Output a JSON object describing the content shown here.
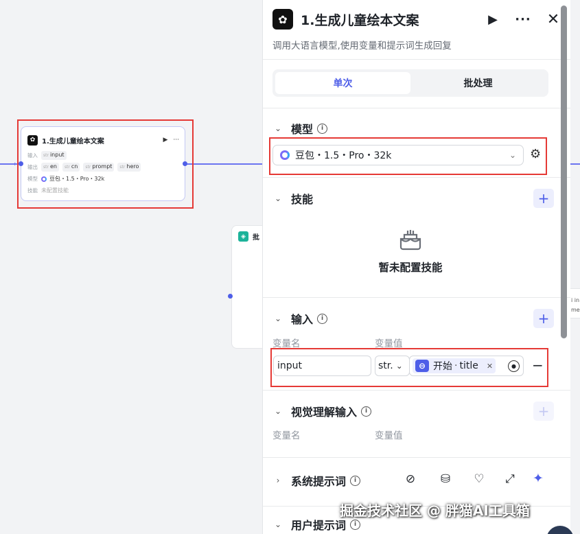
{
  "canvas": {
    "node1": {
      "title": "1.生成儿童绘本文案",
      "run_icon": "▶",
      "more_icon": "···",
      "input_key": "输入",
      "input_tag": "input",
      "output_key": "输出",
      "output_tags": [
        "en",
        "cn",
        "prompt",
        "hero"
      ],
      "model_key": "模型",
      "model": "豆包・1.5・Pro・32k",
      "skill_key": "技能",
      "skill": "未配置技能"
    },
    "node2": {
      "title_fragment": "批"
    },
    "right_fragments": [
      "i in",
      "me"
    ]
  },
  "panel": {
    "title": "1.生成儿童绘本文案",
    "description": "调用大语言模型,使用变量和提示词生成回复",
    "tabs": [
      {
        "label": "单次",
        "active": true
      },
      {
        "label": "批处理",
        "active": false
      }
    ],
    "model_section": {
      "title": "模型",
      "selected": "豆包・1.5・Pro・32k"
    },
    "skills_section": {
      "title": "技能",
      "empty_text": "暂未配置技能"
    },
    "input_section": {
      "title": "输入",
      "col_name": "变量名",
      "col_value": "变量值",
      "row": {
        "name": "input",
        "type": "str.",
        "ref_node": "开始",
        "ref_sep": "·",
        "ref_field": "title"
      }
    },
    "visual_section": {
      "title": "视觉理解输入",
      "col_name": "变量名",
      "col_value": "变量值"
    },
    "system_prompt": {
      "title": "系统提示词"
    },
    "user_prompt": {
      "title": "用户提示词"
    }
  },
  "watermark": "掘金技术社区 @ 胖猫AI工具箱",
  "colors": {
    "accent": "#4e5ee8",
    "highlight": "#e53935",
    "chip_bg": "#eceefd"
  }
}
